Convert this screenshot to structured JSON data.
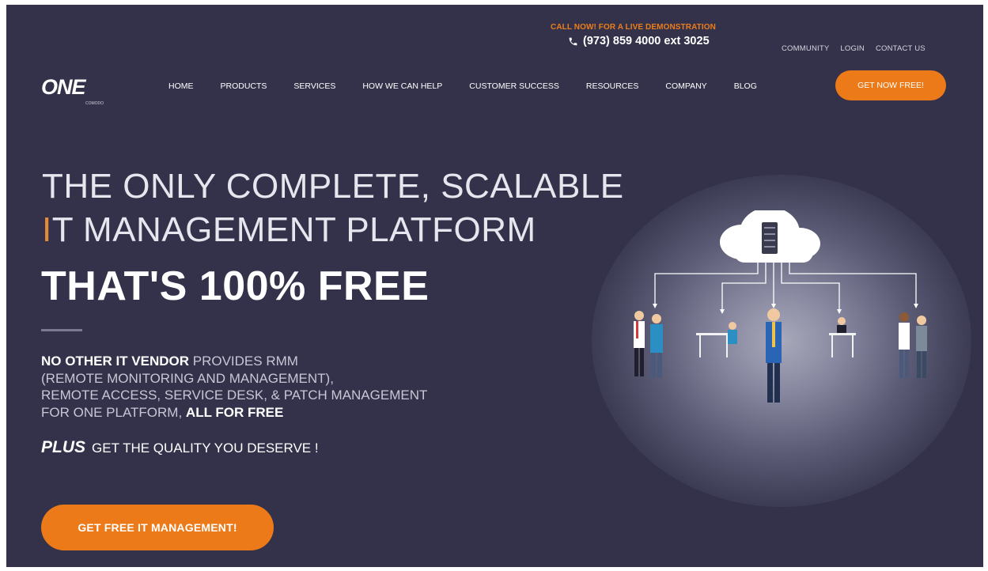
{
  "topbar": {
    "call_label": "CALL NOW! FOR A LIVE DEMONSTRATION",
    "phone": "(973) 859 4000 ext 3025",
    "links": [
      "COMMUNITY",
      "LOGIN",
      "CONTACT US"
    ]
  },
  "logo": {
    "word": "ONE",
    "sub": "COMODO"
  },
  "nav": {
    "items": [
      "HOME",
      "PRODUCTS",
      "SERVICES",
      "HOW WE CAN HELP",
      "CUSTOMER SUCCESS",
      "RESOURCES",
      "COMPANY",
      "BLOG"
    ],
    "cta": "GET NOW FREE!"
  },
  "hero": {
    "line1": "THE ONLY COMPLETE, SCALABLE",
    "line2_accent": "I",
    "line2_rest": "T MANAGEMENT PLATFORM",
    "headline": "THAT'S 100% FREE",
    "desc": {
      "strong1": "NO OTHER IT VENDOR",
      "t1": " PROVIDES RMM",
      "t2": "(REMOTE MONITORING AND MANAGEMENT),",
      "t3": "REMOTE ACCESS, SERVICE DESK, & PATCH MANAGEMENT",
      "t4": "FOR ONE PLATFORM, ",
      "strong2": "ALL FOR FREE"
    },
    "plus_label": "PLUS",
    "plus_text": "GET THE QUALITY YOU DESERVE !",
    "cta": "GET FREE IT MANAGEMENT!"
  },
  "colors": {
    "background": "#33324a",
    "accent": "#ec7a19",
    "cloud": "#ffffff"
  },
  "icons": {
    "phone": "phone-icon",
    "cloud": "cloud-server-icon"
  }
}
